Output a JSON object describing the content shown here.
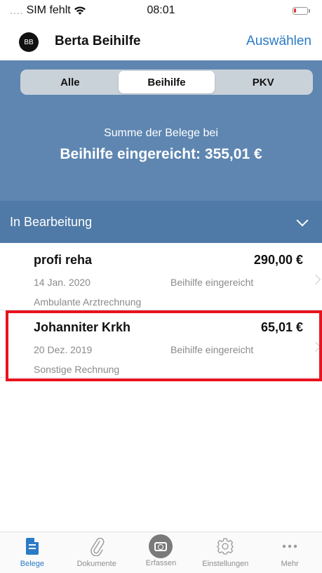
{
  "status_bar": {
    "carrier": "SIM fehlt",
    "time": "08:01"
  },
  "header": {
    "avatar_initials": "BB",
    "title": "Berta Beihilfe",
    "action_label": "Auswählen"
  },
  "segmented_control": {
    "options": [
      "Alle",
      "Beihilfe",
      "PKV"
    ],
    "selected": "Beihilfe"
  },
  "summary": {
    "caption": "Summe der Belege bei",
    "amount_text": "Beihilfe eingereicht: 355,01 €"
  },
  "section": {
    "label": "In Bearbeitung"
  },
  "receipts": [
    {
      "title": "profi reha",
      "amount": "290,00 €",
      "date": "14 Jan. 2020",
      "status": "Beihilfe eingereicht",
      "type": "Ambulante Arztrechnung"
    },
    {
      "title": "Johanniter Krkh",
      "amount": "65,01 €",
      "date": "20 Dez. 2019",
      "status": "Beihilfe eingereicht",
      "type": "Sonstige Rechnung"
    }
  ],
  "tab_bar": {
    "items": [
      {
        "label": "Belege",
        "icon": "document-icon"
      },
      {
        "label": "Dokumente",
        "icon": "paperclip-icon"
      },
      {
        "label": "Erfassen",
        "icon": "camera-icon"
      },
      {
        "label": "Einstellungen",
        "icon": "gear-icon"
      },
      {
        "label": "Mehr",
        "icon": "more-icon"
      }
    ],
    "active": "Belege"
  },
  "colors": {
    "accent": "#2b7bc6",
    "summary_bg": "#5e86b1",
    "section_bg": "#4f79a6",
    "highlight": "#e8131f"
  }
}
